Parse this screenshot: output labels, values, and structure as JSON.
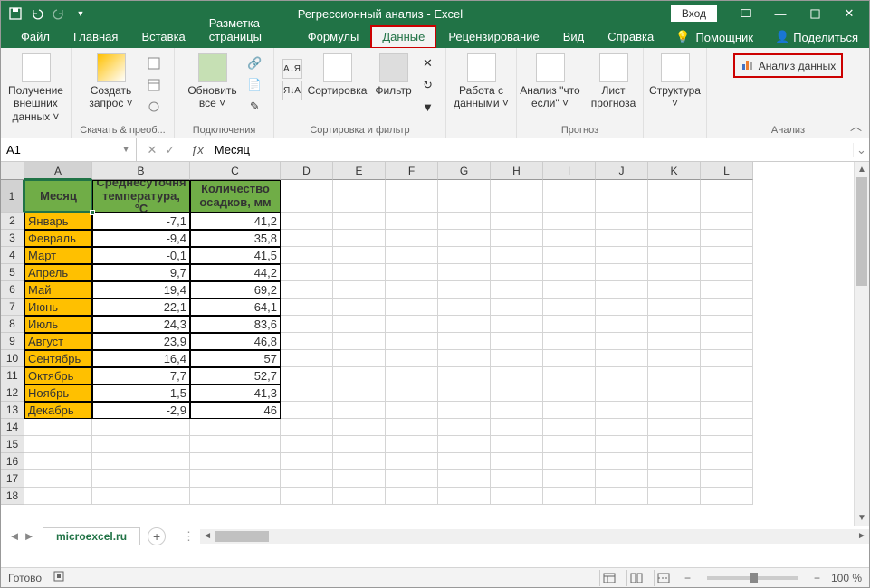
{
  "title_bar": {
    "doc_title": "Регрессионный анализ  -  Excel",
    "login": "Вход"
  },
  "tabs": {
    "file": "Файл",
    "home": "Главная",
    "insert": "Вставка",
    "layout": "Разметка страницы",
    "formulas": "Формулы",
    "data": "Данные",
    "review": "Рецензирование",
    "view": "Вид",
    "help": "Справка",
    "tell_me": "Помощник",
    "share": "Поделиться"
  },
  "ribbon": {
    "get_ext": "Получение внешних данных ˅",
    "new_query": "Создать запрос ˅",
    "get_transform": "Скачать & преоб...",
    "refresh": "Обновить все ˅",
    "connections": "Подключения",
    "sort_az": "А↓Я",
    "sort_za": "Я↓А",
    "sort": "Сортировка",
    "filter": "Фильтр",
    "sort_filter": "Сортировка и фильтр",
    "data_tools": "Работа с данными ˅",
    "what_if": "Анализ \"что если\" ˅",
    "forecast_sheet": "Лист прогноза",
    "forecast": "Прогноз",
    "structure": "Структура ˅",
    "data_analysis": "Анализ данных",
    "analysis": "Анализ"
  },
  "formula_bar": {
    "name_box": "A1",
    "value": "Месяц"
  },
  "columns": [
    "A",
    "B",
    "C",
    "D",
    "E",
    "F",
    "G",
    "H",
    "I",
    "J",
    "K",
    "L"
  ],
  "col_widths": {
    "A": 75,
    "B": 108,
    "C": 100,
    "D": 58,
    "E": 58,
    "F": 58,
    "G": 58,
    "H": 58,
    "I": 58,
    "J": 58,
    "K": 58,
    "L": 58
  },
  "row_heights": {
    "1": 36,
    "default": 19
  },
  "headers": {
    "A": "Месяц",
    "B": "Среднесуточня температура, °C",
    "C": "Количество осадков, мм"
  },
  "rows": [
    {
      "n": 2,
      "month": "Январь",
      "temp": "-7,1",
      "precip": "41,2"
    },
    {
      "n": 3,
      "month": "Февраль",
      "temp": "-9,4",
      "precip": "35,8"
    },
    {
      "n": 4,
      "month": "Март",
      "temp": "-0,1",
      "precip": "41,5"
    },
    {
      "n": 5,
      "month": "Апрель",
      "temp": "9,7",
      "precip": "44,2"
    },
    {
      "n": 6,
      "month": "Май",
      "temp": "19,4",
      "precip": "69,2"
    },
    {
      "n": 7,
      "month": "Июнь",
      "temp": "22,1",
      "precip": "64,1"
    },
    {
      "n": 8,
      "month": "Июль",
      "temp": "24,3",
      "precip": "83,6"
    },
    {
      "n": 9,
      "month": "Август",
      "temp": "23,9",
      "precip": "46,8"
    },
    {
      "n": 10,
      "month": "Сентябрь",
      "temp": "16,4",
      "precip": "57"
    },
    {
      "n": 11,
      "month": "Октябрь",
      "temp": "7,7",
      "precip": "52,7"
    },
    {
      "n": 12,
      "month": "Ноябрь",
      "temp": "1,5",
      "precip": "41,3"
    },
    {
      "n": 13,
      "month": "Декабрь",
      "temp": "-2,9",
      "precip": "46"
    }
  ],
  "visible_rows": 18,
  "sheet_tab": "microexcel.ru",
  "status": {
    "ready": "Готово",
    "zoom": "100 %"
  }
}
